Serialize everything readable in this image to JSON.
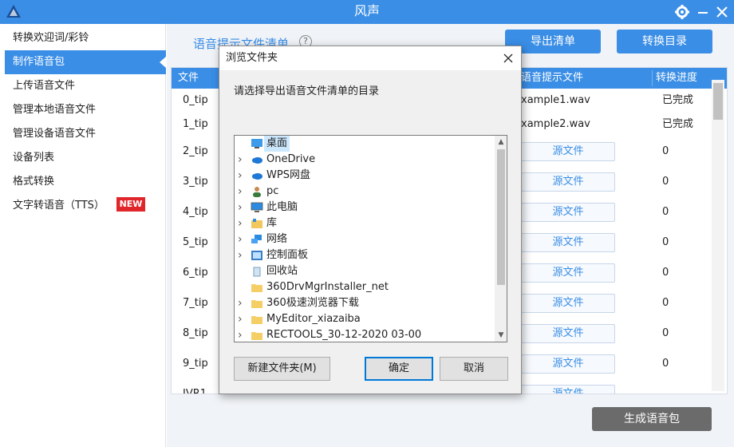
{
  "app": {
    "title": "风声"
  },
  "sidebar": {
    "items": [
      {
        "label": "转换欢迎词/彩铃"
      },
      {
        "label": "制作语音包"
      },
      {
        "label": "上传语音文件"
      },
      {
        "label": "管理本地语音文件"
      },
      {
        "label": "管理设备语音文件"
      },
      {
        "label": "设备列表"
      },
      {
        "label": "格式转换"
      },
      {
        "label": "文字转语音（TTS）"
      }
    ],
    "new_badge": "NEW"
  },
  "main": {
    "section_title": "语音提示文件清单",
    "help_glyph": "?",
    "export_button": "导出清单",
    "convert_dir_button": "转换目录",
    "generate_button": "生成语音包",
    "table": {
      "headers": {
        "file": "文件",
        "prompt_file": "语音提示文件",
        "progress": "转换进度"
      },
      "rows": [
        {
          "name": "0_tip",
          "file": "xample1.wav",
          "progress": "已完成"
        },
        {
          "name": "1_tip",
          "file": "xample2.wav",
          "progress": "已完成"
        },
        {
          "name": "2_tip",
          "file": "源文件",
          "progress": "0"
        },
        {
          "name": "3_tip",
          "file": "源文件",
          "progress": "0"
        },
        {
          "name": "4_tip",
          "file": "源文件",
          "progress": "0"
        },
        {
          "name": "5_tip",
          "file": "源文件",
          "progress": "0"
        },
        {
          "name": "6_tip",
          "file": "源文件",
          "progress": "0"
        },
        {
          "name": "7_tip",
          "file": "源文件",
          "progress": "0"
        },
        {
          "name": "8_tip",
          "file": "源文件",
          "progress": "0"
        },
        {
          "name": "9_tip",
          "file": "源文件",
          "progress": "0"
        },
        {
          "name": "IVR1",
          "file": "源文件",
          "progress": ""
        }
      ]
    }
  },
  "dialog": {
    "title": "浏览文件夹",
    "prompt": "请选择导出语音文件清单的目录",
    "tree": [
      {
        "label": "桌面",
        "icon": "desktop-icon",
        "expand": false
      },
      {
        "label": "OneDrive",
        "icon": "cloud-icon",
        "expand": true
      },
      {
        "label": "WPS网盘",
        "icon": "cloud-icon",
        "expand": true
      },
      {
        "label": "pc",
        "icon": "user-icon",
        "expand": true
      },
      {
        "label": "此电脑",
        "icon": "computer-icon",
        "expand": true
      },
      {
        "label": "库",
        "icon": "library-icon",
        "expand": true
      },
      {
        "label": "网络",
        "icon": "network-icon",
        "expand": true
      },
      {
        "label": "控制面板",
        "icon": "control-panel-icon",
        "expand": true
      },
      {
        "label": "回收站",
        "icon": "recycle-bin-icon",
        "expand": false
      },
      {
        "label": "360DrvMgrInstaller_net",
        "icon": "folder-icon",
        "expand": false
      },
      {
        "label": "360极速浏览器下载",
        "icon": "folder-icon",
        "expand": true
      },
      {
        "label": "MyEditor_xiazaiba",
        "icon": "folder-icon",
        "expand": true
      },
      {
        "label": "RECTOOLS_30-12-2020 03-00",
        "icon": "folder-icon",
        "expand": true
      }
    ],
    "new_folder_button": "新建文件夹(M)",
    "ok_button": "确定",
    "cancel_button": "取消"
  },
  "colors": {
    "accent": "#3a8ee6",
    "badge": "#e0262b"
  }
}
